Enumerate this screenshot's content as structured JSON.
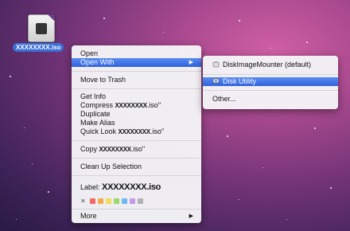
{
  "desktop": {
    "file_label": "XXXXXXXX.iso"
  },
  "context_menu": {
    "open": "Open",
    "open_with": "Open With",
    "move_to_trash": "Move to Trash",
    "get_info": "Get Info",
    "compress_prefix": "Compress ",
    "compress_name": "XXXXXXXX",
    "compress_suffix": ".iso\"",
    "duplicate": "Duplicate",
    "make_alias": "Make Alias",
    "quick_look_prefix": "Quick Look ",
    "quick_look_name": "XXXXXXXX",
    "quick_look_suffix": ".iso\"",
    "copy_prefix": "Copy ",
    "copy_name": "XXXXXXXX",
    "copy_suffix": ".iso\"",
    "clean_up_selection": "Clean Up Selection",
    "label_prefix": "Label: ",
    "label_name": "XXXXXXXX.iso",
    "label_none_glyph": "✕",
    "label_colors": [
      "#f06b64",
      "#f4a94e",
      "#f1dd5b",
      "#9ed86c",
      "#74b8f0",
      "#c49be6",
      "#b3b3b3"
    ],
    "more": "More",
    "submenu_arrow": "▶"
  },
  "open_with_submenu": {
    "default_app": "DiskImageMounter (default)",
    "default_app_icon": "disk-image-mounter-icon",
    "selected_app": "Disk Utility",
    "selected_app_icon": "disk-utility-icon",
    "other": "Other..."
  },
  "colors": {
    "selection": "#3a6fe2"
  }
}
